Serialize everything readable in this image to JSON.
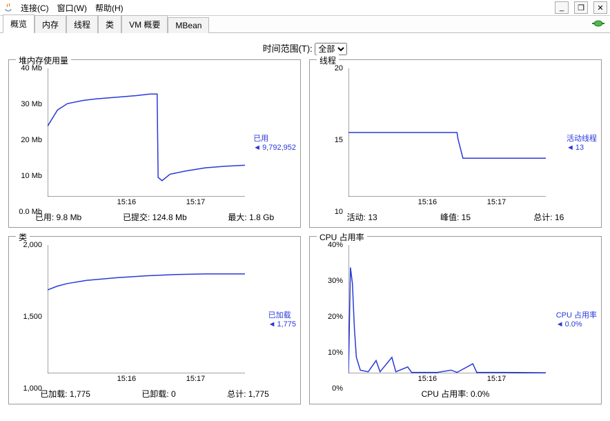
{
  "menu": {
    "connect": "连接(C)",
    "window": "窗口(W)",
    "help": "帮助(H)"
  },
  "window_buttons": {
    "min": "_",
    "max": "❐",
    "close": "✕"
  },
  "tabs": {
    "overview": "概览",
    "memory": "内存",
    "threads": "线程",
    "classes": "类",
    "vm_summary": "VM 概要",
    "mbean": "MBean"
  },
  "time_range": {
    "label": "时间范围(T):",
    "selected": "全部"
  },
  "panels": {
    "heap": {
      "title": "堆内存使用量",
      "side_label": "已用",
      "side_value": "9,792,952",
      "footer": {
        "used_label": "已用:",
        "used_value": "9.8 Mb",
        "committed_label": "已提交:",
        "committed_value": "124.8 Mb",
        "max_label": "最大:",
        "max_value": "1.8 Gb"
      }
    },
    "threads": {
      "title": "线程",
      "side_label": "活动线程",
      "side_value": "13",
      "footer": {
        "live_label": "活动:",
        "live_value": "13",
        "peak_label": "峰值:",
        "peak_value": "15",
        "total_label": "总计:",
        "total_value": "16"
      }
    },
    "classes": {
      "title": "类",
      "side_label": "已加载",
      "side_value": "1,775",
      "footer": {
        "loaded_label": "已加载:",
        "loaded_value": "1,775",
        "unloaded_label": "已卸载:",
        "unloaded_value": "0",
        "total_label": "总计:",
        "total_value": "1,775"
      }
    },
    "cpu": {
      "title": "CPU 占用率",
      "side_label": "CPU 占用率",
      "side_value": "0.0%",
      "footer": {
        "label": "CPU 占用率:",
        "value": "0.0%"
      }
    }
  },
  "chart_data": [
    {
      "id": "heap",
      "type": "line",
      "title": "堆内存使用量",
      "xlabel": "",
      "ylabel": "",
      "ylim": [
        0,
        40
      ],
      "y_unit": "Mb",
      "y_ticks": [
        0.0,
        10,
        20,
        30,
        40
      ],
      "y_tick_labels": [
        "0.0 Mb",
        "10 Mb",
        "20 Mb",
        "30 Mb",
        "40 Mb"
      ],
      "x_ticks": [
        0.4,
        0.75
      ],
      "x_tick_labels": [
        "15:16",
        "15:17"
      ],
      "series": [
        {
          "name": "已用",
          "points": [
            [
              0.0,
              22
            ],
            [
              0.05,
              27
            ],
            [
              0.1,
              29
            ],
            [
              0.18,
              30
            ],
            [
              0.25,
              30.5
            ],
            [
              0.35,
              31
            ],
            [
              0.45,
              31.5
            ],
            [
              0.52,
              32
            ],
            [
              0.555,
              32
            ],
            [
              0.56,
              6
            ],
            [
              0.58,
              5
            ],
            [
              0.62,
              7
            ],
            [
              0.7,
              8
            ],
            [
              0.8,
              9
            ],
            [
              0.9,
              9.5
            ],
            [
              1.0,
              9.8
            ]
          ]
        }
      ]
    },
    {
      "id": "threads",
      "type": "line",
      "title": "线程",
      "ylim": [
        10,
        20
      ],
      "y_ticks": [
        10,
        15,
        20
      ],
      "y_tick_labels": [
        "10",
        "15",
        "20"
      ],
      "x_ticks": [
        0.4,
        0.75
      ],
      "x_tick_labels": [
        "15:16",
        "15:17"
      ],
      "series": [
        {
          "name": "活动线程",
          "points": [
            [
              0.0,
              15
            ],
            [
              0.55,
              15
            ],
            [
              0.555,
              14.5
            ],
            [
              0.58,
              13
            ],
            [
              1.0,
              13
            ]
          ]
        }
      ]
    },
    {
      "id": "classes",
      "type": "line",
      "title": "类",
      "ylim": [
        1000,
        2000
      ],
      "y_ticks": [
        1000,
        1500,
        2000
      ],
      "y_tick_labels": [
        "1,000",
        "1,500",
        "2,000"
      ],
      "x_ticks": [
        0.4,
        0.75
      ],
      "x_tick_labels": [
        "15:16",
        "15:17"
      ],
      "series": [
        {
          "name": "已加载",
          "points": [
            [
              0.0,
              1650
            ],
            [
              0.05,
              1680
            ],
            [
              0.1,
              1700
            ],
            [
              0.2,
              1725
            ],
            [
              0.35,
              1745
            ],
            [
              0.5,
              1760
            ],
            [
              0.65,
              1770
            ],
            [
              0.8,
              1775
            ],
            [
              1.0,
              1775
            ]
          ]
        }
      ]
    },
    {
      "id": "cpu",
      "type": "line",
      "title": "CPU 占用率",
      "ylim": [
        0,
        40
      ],
      "y_unit": "%",
      "y_ticks": [
        0,
        10,
        20,
        30,
        40
      ],
      "y_tick_labels": [
        "0%",
        "10%",
        "20%",
        "30%",
        "40%"
      ],
      "x_ticks": [
        0.4,
        0.75
      ],
      "x_tick_labels": [
        "15:16",
        "15:17"
      ],
      "series": [
        {
          "name": "CPU 占用率",
          "points": [
            [
              0.0,
              0
            ],
            [
              0.01,
              33
            ],
            [
              0.02,
              28
            ],
            [
              0.03,
              14
            ],
            [
              0.04,
              5
            ],
            [
              0.06,
              1
            ],
            [
              0.1,
              0.5
            ],
            [
              0.14,
              4
            ],
            [
              0.16,
              0.5
            ],
            [
              0.22,
              5
            ],
            [
              0.24,
              0.5
            ],
            [
              0.3,
              2
            ],
            [
              0.32,
              0.3
            ],
            [
              0.45,
              0.3
            ],
            [
              0.52,
              1
            ],
            [
              0.55,
              0.3
            ],
            [
              0.63,
              3
            ],
            [
              0.65,
              0.3
            ],
            [
              0.8,
              0.3
            ],
            [
              1.0,
              0.2
            ]
          ]
        }
      ]
    }
  ]
}
